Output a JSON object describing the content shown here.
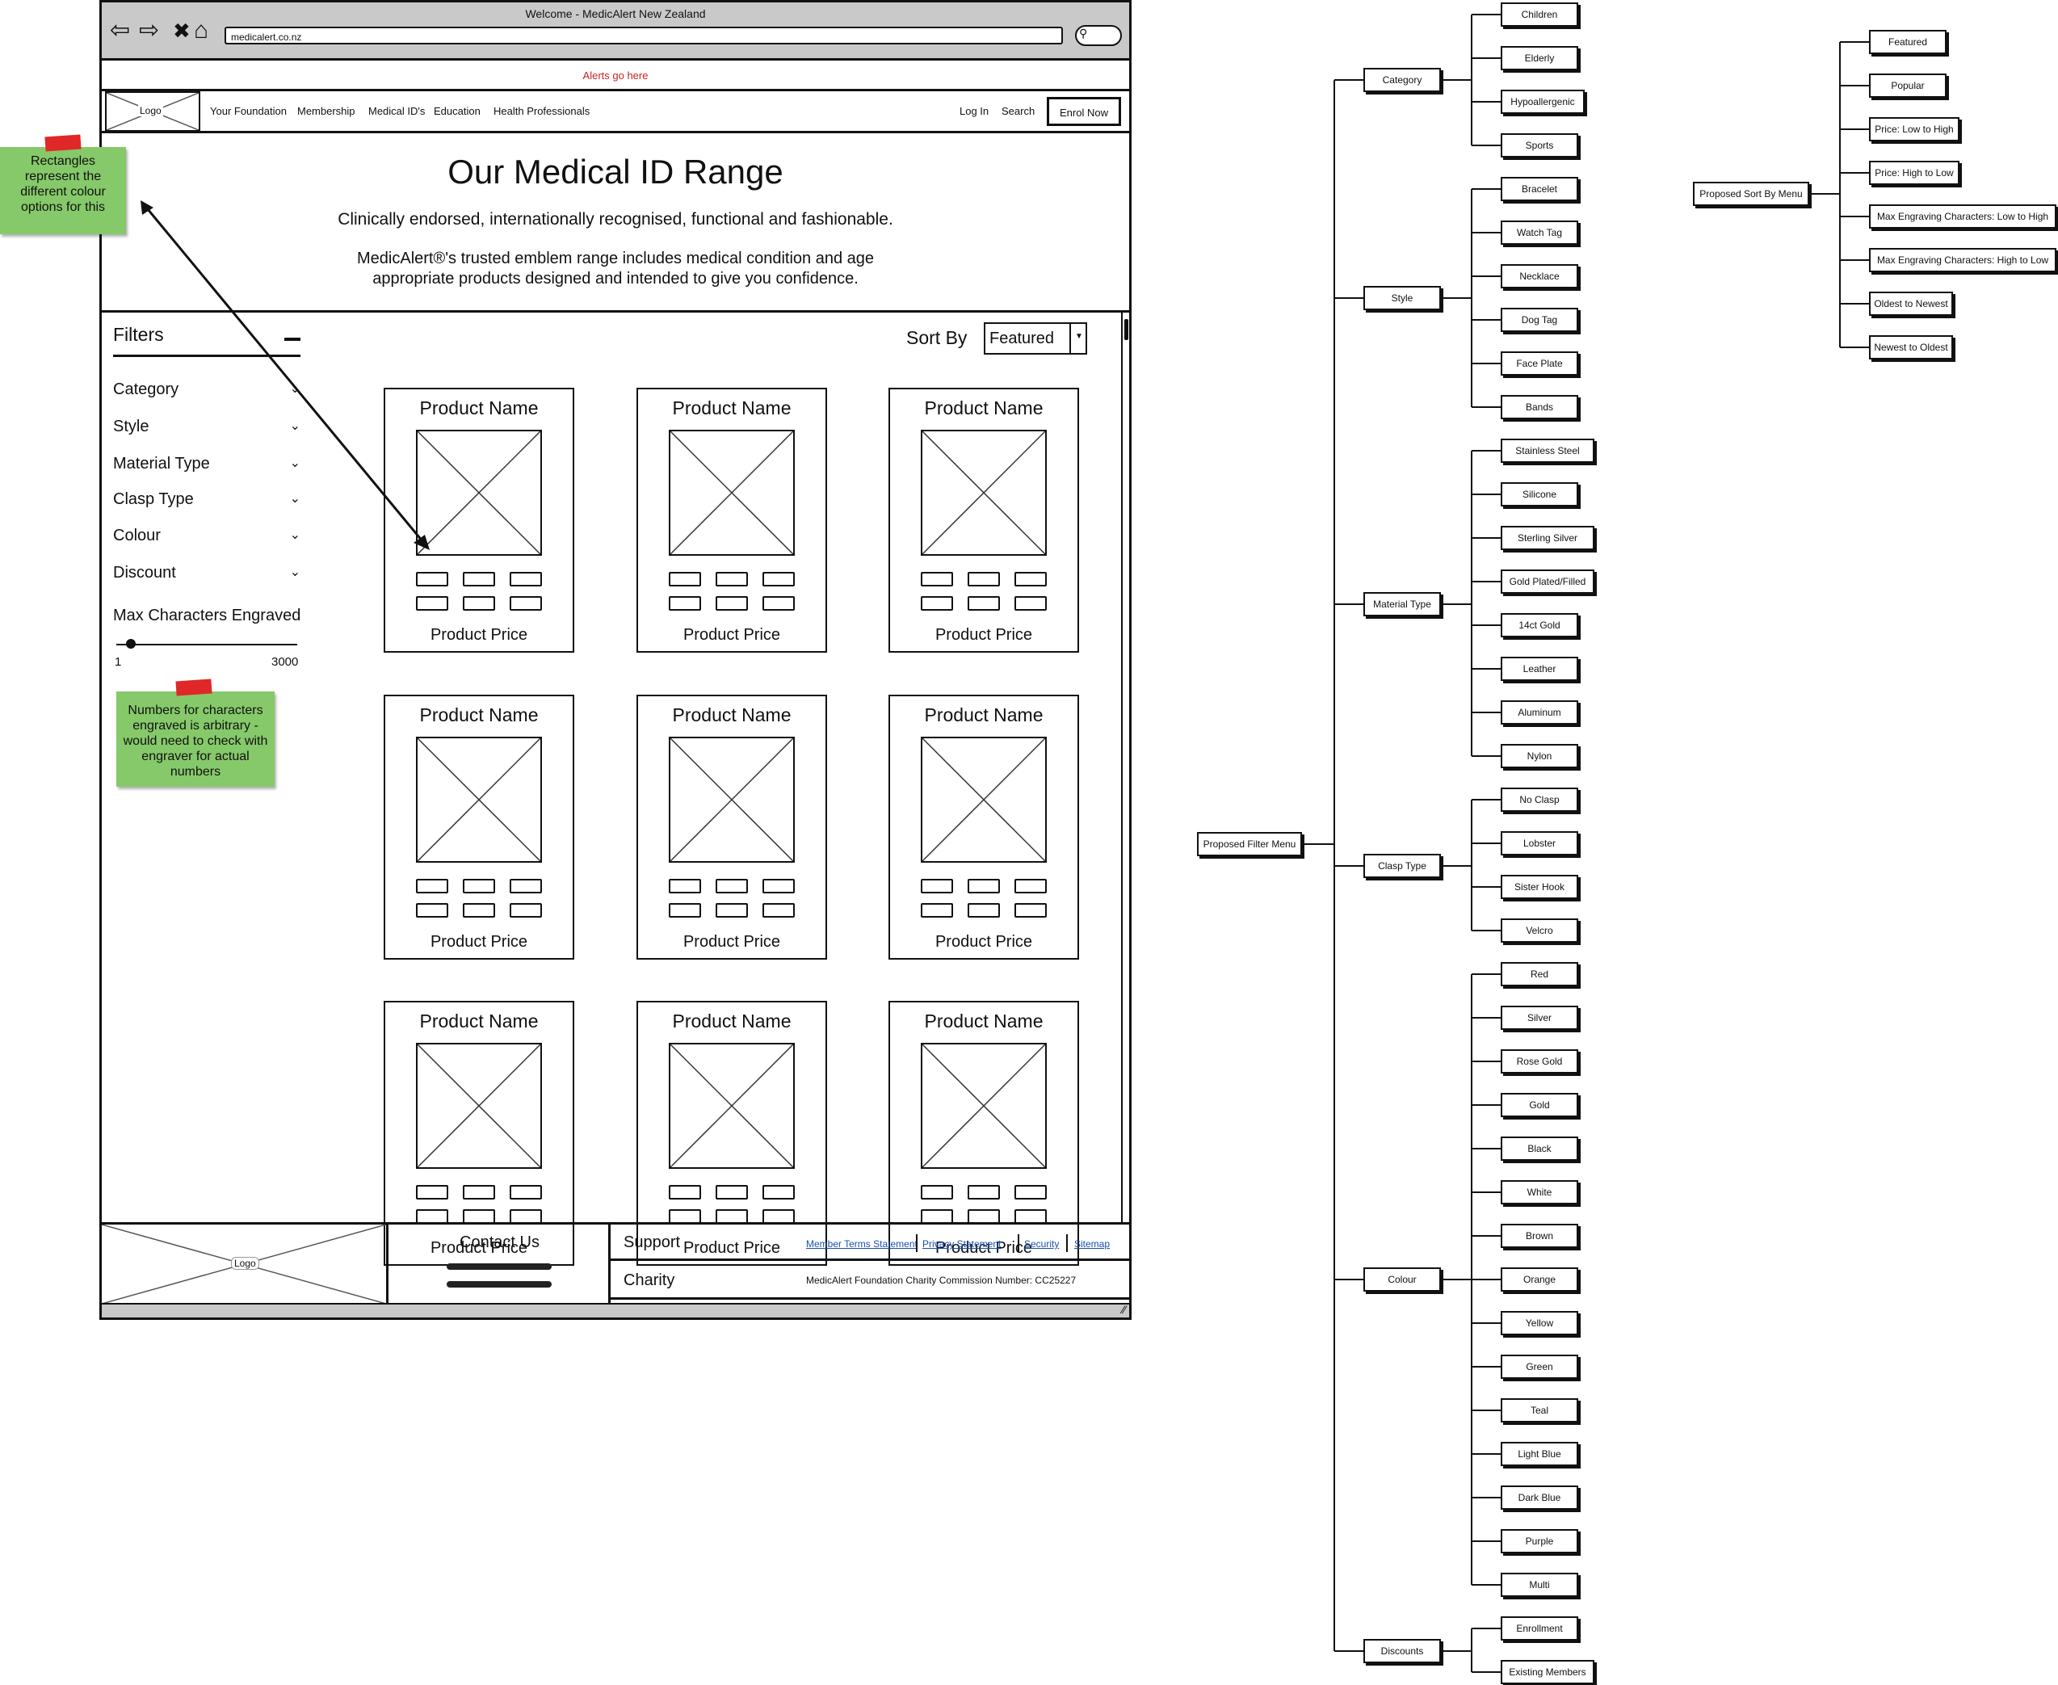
{
  "browser": {
    "window_title": "Welcome - MedicAlert New Zealand",
    "url": "medicalert.co.nz",
    "alert_text": "Alerts go here"
  },
  "header": {
    "logo": "Logo",
    "nav": [
      "Your Foundation",
      "Membership",
      "Medical ID's",
      "Education",
      "Health Professionals"
    ],
    "login": "Log In",
    "search": "Search",
    "enrol": "Enrol Now"
  },
  "hero": {
    "title": "Our Medical ID Range",
    "subtitle": "Clinically endorsed, internationally recognised, functional and fashionable.",
    "description": "MedicAlert®'s trusted emblem range includes medical condition and age appropriate products designed and intended to give you confidence."
  },
  "filters": {
    "title": "Filters",
    "items": [
      "Category",
      "Style",
      "Material Type",
      "Clasp Type",
      "Colour",
      "Discount"
    ],
    "max_chars_label": "Max Characters Engraved",
    "slider_min": "1",
    "slider_max": "3000",
    "slider_value": 0.05
  },
  "sort": {
    "label": "Sort By",
    "selected": "Featured"
  },
  "products": {
    "name": "Product Name",
    "price": "Product Price"
  },
  "footer": {
    "logo": "Logo",
    "contact_title": "Contact Us",
    "support_title": "Support",
    "support_links": [
      "Member Terms Statement",
      "Privacy Statement",
      "Security",
      "Sitemap"
    ],
    "charity_title": "Charity",
    "charity_text": "MedicAlert Foundation Charity Commission Number: CC25227"
  },
  "notes": {
    "colour_note": "Rectangles represent the different colour options for this",
    "chars_note": "Numbers for characters engraved is arbitrary - would need to check with engraver for actual numbers"
  },
  "filter_menu": {
    "root": "Proposed Filter Menu",
    "groups": [
      {
        "label": "Category",
        "children": [
          "Children",
          "Elderly",
          "Hypoallergenic",
          "Sports"
        ]
      },
      {
        "label": "Style",
        "children": [
          "Bracelet",
          "Watch Tag",
          "Necklace",
          "Dog Tag",
          "Face Plate",
          "Bands"
        ]
      },
      {
        "label": "Material Type",
        "children": [
          "Stainless Steel",
          "Silicone",
          "Sterling Silver",
          "Gold Plated/Filled",
          "14ct Gold",
          "Leather",
          "Aluminum",
          "Nylon"
        ]
      },
      {
        "label": "Clasp Type",
        "children": [
          "No Clasp",
          "Lobster",
          "Sister Hook",
          "Velcro"
        ]
      },
      {
        "label": "Colour",
        "children": [
          "Red",
          "Silver",
          "Rose Gold",
          "Gold",
          "Black",
          "White",
          "Brown",
          "Orange",
          "Yellow",
          "Green",
          "Teal",
          "Light Blue",
          "Dark Blue",
          "Purple",
          "Multi"
        ]
      },
      {
        "label": "Discounts",
        "children": [
          "Enrollment",
          "Existing Members"
        ]
      }
    ]
  },
  "sort_menu": {
    "root": "Proposed Sort By Menu",
    "children": [
      "Featured",
      "Popular",
      "Price: Low to High",
      "Price: High to Low",
      "Max Engraving Characters: Low to High",
      "Max Engraving Characters: High to Low",
      "Oldest to Newest",
      "Newest to Oldest"
    ]
  }
}
